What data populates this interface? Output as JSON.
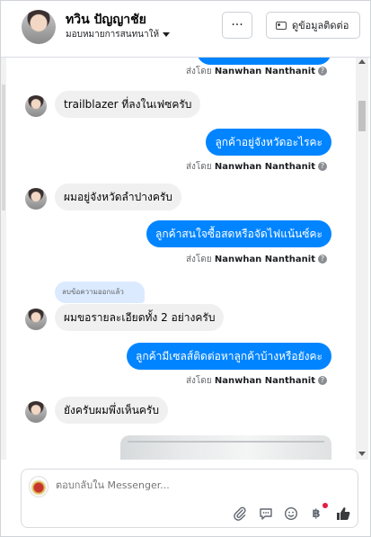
{
  "header": {
    "contact_name": "ทวิน ปัญญาชัย",
    "assign_label": "มอบหมายการสนทนาให้",
    "more_label": "···",
    "view_contact_label": "ดูข้อมูลติดต่อ"
  },
  "thread": {
    "sent_by_prefix": "ส่งโดย",
    "sender": "Nanwhan Nanthanit",
    "deleted_label": "ลบข้อความออกแล้ว",
    "messages": [
      {
        "dir": "in",
        "text": "trailblazer ที่ลงในเฟซครับ"
      },
      {
        "dir": "out",
        "text": "ลูกค้าอยู่จังหวัดอะไรคะ"
      },
      {
        "dir": "in",
        "text": "ผมอยู่จังหวัดลำปางครับ"
      },
      {
        "dir": "out",
        "text": "ลูกค้าสนใจซื้อสดหรือจัดไฟแน้นซ์คะ"
      },
      {
        "dir": "in",
        "text": "ผมขอรายละเอียดทั้ง 2 อย่างครับ"
      },
      {
        "dir": "out",
        "text": "ลูกค้ามีเซลส์ติดต่อหาลูกค้าบ้างหรือยังคะ"
      },
      {
        "dir": "in",
        "text": "ยังครับผมพึ่งเห็นครับ"
      }
    ]
  },
  "composer": {
    "placeholder": "ตอบกลับใน Messenger..."
  },
  "icons": [
    "chevron-down-icon",
    "more-icon",
    "contact-card-icon",
    "help-icon",
    "attachment-icon",
    "saved-reply-icon",
    "emoji-icon",
    "bold-icon",
    "like-icon"
  ],
  "colors": {
    "outgoing_bubble": "#0084ff",
    "incoming_bubble": "#f0f0f0",
    "deleted_tag": "#dbeafe"
  }
}
